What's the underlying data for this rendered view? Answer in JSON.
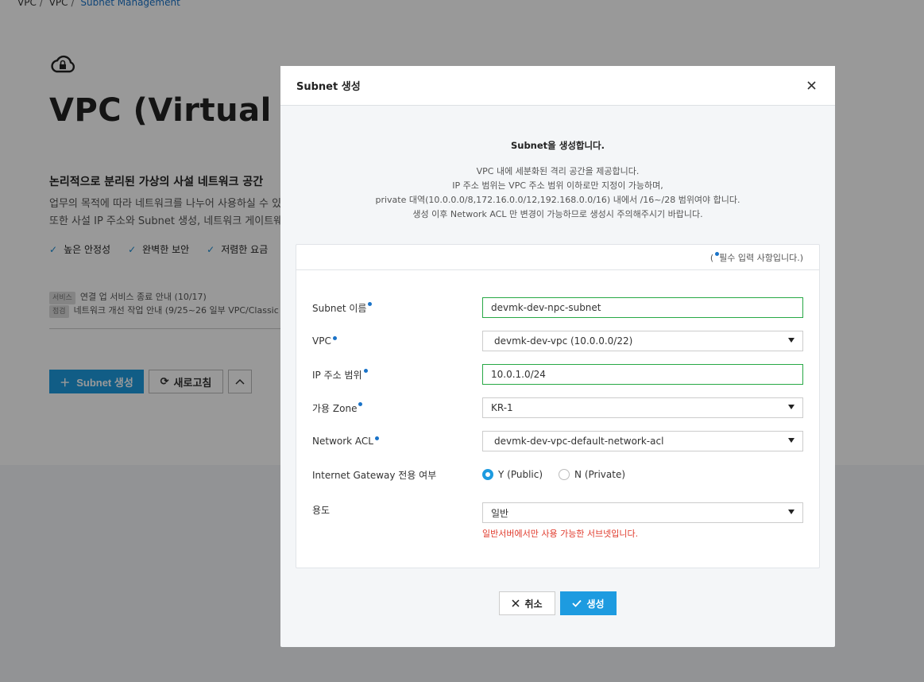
{
  "breadcrumb": [
    "VPC",
    "VPC",
    "Subnet Management"
  ],
  "page": {
    "title": "VPC (Virtual P",
    "subtitle": "논리적으로 분리된 가상의 사설 네트워크 공간",
    "desc_line1": "업무의 목적에 따라 네트워크를 나누어 사용하실 수 있",
    "desc_line2": "또한 사설 IP 주소와 Subnet 생성, 네트워크 게이트웨",
    "features": [
      "높은 안정성",
      "완벽한 보안",
      "저렴한 요금"
    ],
    "notice1_tag": "서비스",
    "notice1": "연결 업 서비스 종료 안내 (10/17)",
    "notice2_tag": "점검",
    "notice2": "네트워크 개선 작업 안내 (9/25~26 일부 VPC/Classic",
    "create_label": "Subnet 생성",
    "refresh_label": "새로고침"
  },
  "modal": {
    "title": "Subnet 생성",
    "intro_title": "Subnet을 생성합니다.",
    "intro_lines": [
      "VPC 내에 세분화된 격리 공간을 제공합니다.",
      "IP 주소 범위는 VPC 주소 범위 이하로만 지정이 가능하며,",
      "private 대역(10.0.0.0/8,172.16.0.0/12,192.168.0.0/16) 내에서 /16~/28 범위여야 합니다.",
      "생성 이후 Network ACL 만 변경이 가능하므로 생성시 주의해주시기 바랍니다."
    ],
    "required_note_prefix": "(",
    "required_note": "필수 입력 사항입니다.)",
    "fields": {
      "subnet_name_label": "Subnet 이름",
      "subnet_name_value": "devmk-dev-npc-subnet",
      "vpc_label": "VPC",
      "vpc_value": "devmk-dev-vpc (10.0.0.0/22)",
      "ip_label": "IP 주소 범위",
      "ip_value": "10.0.1.0/24",
      "zone_label": "가용 Zone",
      "zone_value": "KR-1",
      "acl_label": "Network ACL",
      "acl_value": "devmk-dev-vpc-default-network-acl",
      "igw_label": "Internet Gateway 전용 여부",
      "igw_options": [
        "Y (Public)",
        "N (Private)"
      ],
      "igw_selected": "Y (Public)",
      "usage_label": "용도",
      "usage_value": "일반",
      "usage_hint": "일반서버에서만 사용 가능한 서브넷입니다."
    },
    "cancel_label": "취소",
    "create_label": "생성"
  },
  "colors": {
    "accent": "#1d9be0",
    "link": "#1a73c8",
    "valid_border": "#27a845",
    "error": "#e0392b"
  }
}
